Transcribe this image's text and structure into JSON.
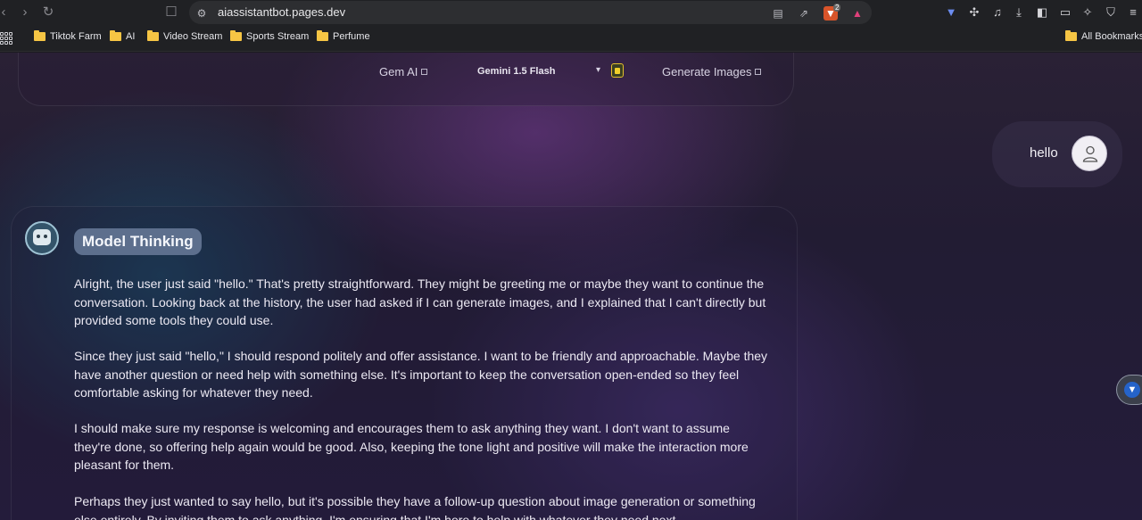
{
  "browser": {
    "url": "aiassistantbot.pages.dev",
    "brave_badge": "2",
    "bookmarks": [
      "Tiktok Farm",
      "AI",
      "Video Stream",
      "Sports Stream",
      "Perfume"
    ],
    "all_bookmarks": "All Bookmarks"
  },
  "nav": {
    "gem_ai": "Gem AI",
    "model": "Gemini 1.5 Flash",
    "generate_images": "Generate Images"
  },
  "chat": {
    "user_message": "hello",
    "thinking_label": "Model Thinking",
    "paragraphs": [
      "Alright, the user just said \"hello.\" That's pretty straightforward. They might be greeting me or maybe they want to continue the conversation. Looking back at the history, the user had asked if I can generate images, and I explained that I can't directly but provided some tools they could use.",
      "Since they just said \"hello,\" I should respond politely and offer assistance. I want to be friendly and approachable. Maybe they have another question or need help with something else. It's important to keep the conversation open-ended so they feel comfortable asking for whatever they need.",
      "I should make sure my response is welcoming and encourages them to ask anything they want. I don't want to assume they're done, so offering help again would be good. Also, keeping the tone light and positive will make the interaction more pleasant for them.",
      "Perhaps they just wanted to say hello, but it's possible they have a follow-up question about image generation or something else entirely. By inviting them to ask anything, I'm ensuring that I'm here to help with whatever they need next."
    ]
  }
}
